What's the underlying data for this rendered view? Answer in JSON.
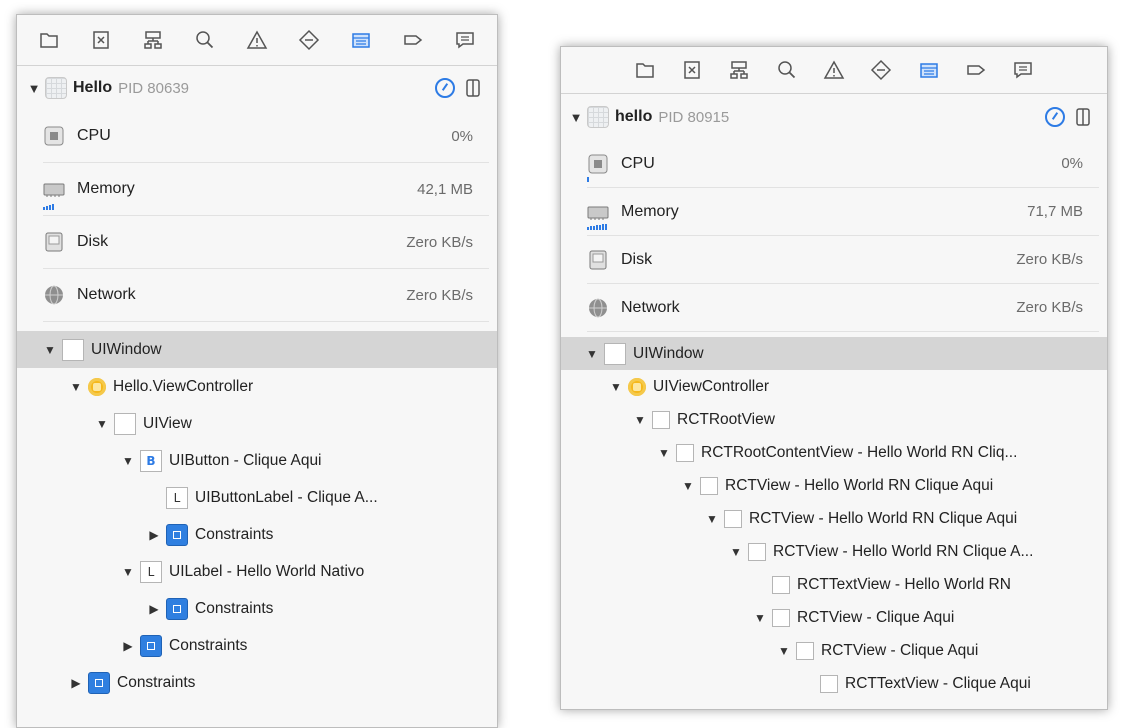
{
  "toolbar_icons": [
    "folder-icon",
    "xcode-file-icon",
    "hierarchy-icon",
    "search-icon",
    "warning-icon",
    "breakpoint-icon",
    "debug-navigator-icon",
    "tag-icon",
    "report-icon"
  ],
  "left": {
    "process": {
      "name": "Hello",
      "pid": "PID 80639"
    },
    "metrics": [
      {
        "key": "cpu",
        "label": "CPU",
        "value": "0%"
      },
      {
        "key": "memory",
        "label": "Memory",
        "value": "42,1 MB"
      },
      {
        "key": "disk",
        "label": "Disk",
        "value": "Zero KB/s"
      },
      {
        "key": "network",
        "label": "Network",
        "value": "Zero KB/s"
      }
    ],
    "tree": [
      {
        "label": "UIWindow",
        "icon": "blank",
        "state": "expanded"
      },
      {
        "label": "Hello.ViewController",
        "icon": "vc",
        "state": "expanded"
      },
      {
        "label": "UIView",
        "icon": "blank",
        "state": "expanded"
      },
      {
        "label": "UIButton - Clique Aqui",
        "icon": "B",
        "state": "expanded"
      },
      {
        "label": "UIButtonLabel - Clique A...",
        "icon": "L",
        "state": "none"
      },
      {
        "label": "Constraints",
        "icon": "constraints",
        "state": "collapsed"
      },
      {
        "label": "UILabel - Hello World Nativo",
        "icon": "L",
        "state": "expanded"
      },
      {
        "label": "Constraints",
        "icon": "constraints",
        "state": "collapsed"
      },
      {
        "label": "Constraints",
        "icon": "constraints",
        "state": "collapsed"
      },
      {
        "label": "Constraints",
        "icon": "constraints",
        "state": "collapsed"
      }
    ]
  },
  "right": {
    "process": {
      "name": "hello",
      "pid": "PID 80915"
    },
    "metrics": [
      {
        "key": "cpu",
        "label": "CPU",
        "value": "0%"
      },
      {
        "key": "memory",
        "label": "Memory",
        "value": "71,7 MB"
      },
      {
        "key": "disk",
        "label": "Disk",
        "value": "Zero KB/s"
      },
      {
        "key": "network",
        "label": "Network",
        "value": "Zero KB/s"
      }
    ],
    "tree": [
      {
        "label": "UIWindow",
        "icon": "blank",
        "state": "expanded"
      },
      {
        "label": "UIViewController",
        "icon": "vc",
        "state": "expanded"
      },
      {
        "label": "RCTRootView",
        "icon": "blank",
        "state": "expanded"
      },
      {
        "label": "RCTRootContentView - Hello World RN Cliq...",
        "icon": "blank",
        "state": "expanded"
      },
      {
        "label": "RCTView - Hello World RN Clique Aqui",
        "icon": "blank",
        "state": "expanded"
      },
      {
        "label": "RCTView - Hello World RN Clique Aqui",
        "icon": "blank",
        "state": "expanded"
      },
      {
        "label": "RCTView - Hello World RN Clique A...",
        "icon": "blank",
        "state": "expanded"
      },
      {
        "label": "RCTTextView - Hello World RN",
        "icon": "blank",
        "state": "none"
      },
      {
        "label": "RCTView - Clique Aqui",
        "icon": "blank",
        "state": "expanded"
      },
      {
        "label": "RCTView - Clique Aqui",
        "icon": "blank",
        "state": "expanded"
      },
      {
        "label": "RCTTextView - Clique Aqui",
        "icon": "blank",
        "state": "none"
      }
    ]
  },
  "colors": {
    "accent": "#2d7be5",
    "selected_row": "#d5d5d5",
    "view_controller": "#f5b81c"
  }
}
